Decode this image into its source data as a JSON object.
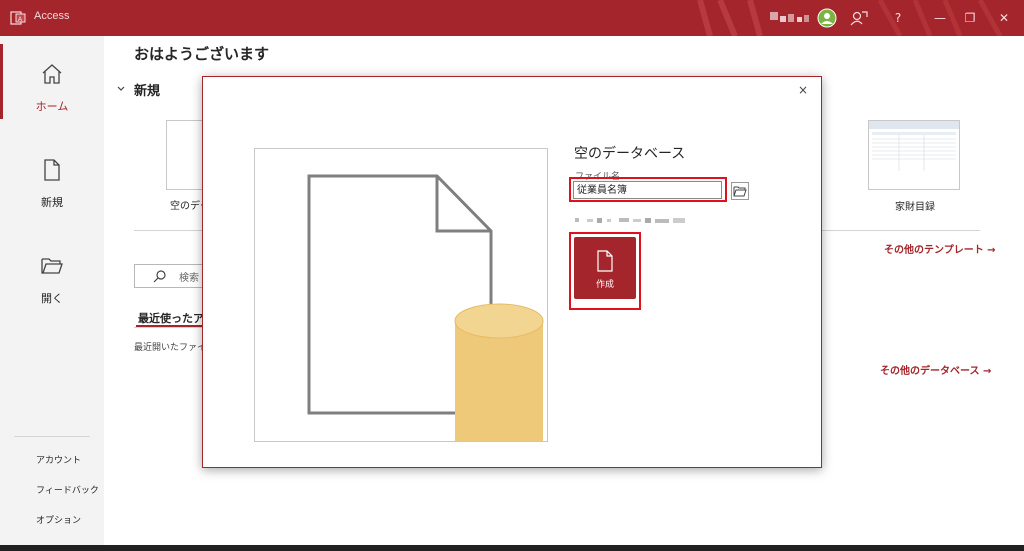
{
  "app": {
    "title": "Access"
  },
  "title_bar": {
    "help": "?",
    "minimize": "—",
    "maximize": "❐",
    "close": "✕"
  },
  "sidebar": {
    "items": [
      {
        "label": "ホーム",
        "icon": "home-icon",
        "selected": true
      },
      {
        "label": "新規",
        "icon": "new-file-icon"
      },
      {
        "label": "開く",
        "icon": "open-folder-icon"
      }
    ],
    "bottom": [
      {
        "label": "アカウント"
      },
      {
        "label": "フィードバック"
      },
      {
        "label": "オプション"
      }
    ]
  },
  "main": {
    "greeting": "おはようございます",
    "new_section": "新規",
    "blank_db_label": "空のデー",
    "template_label": "家財目録",
    "more_templates": "その他のテンプレート →",
    "search_placeholder": "検索",
    "recent_tab": "最近使ったア",
    "recent_empty": "最近開いたファイル",
    "more_databases": "その他のデータベース →"
  },
  "dialog": {
    "title": "空のデータベース",
    "filename_label": "ファイル名",
    "filename_value": "従業員名簿",
    "create_label": "作成",
    "close": "×"
  },
  "colors": {
    "accent": "#a4262c",
    "highlight": "#e0101c",
    "db_cylinder": "#efc97a"
  }
}
